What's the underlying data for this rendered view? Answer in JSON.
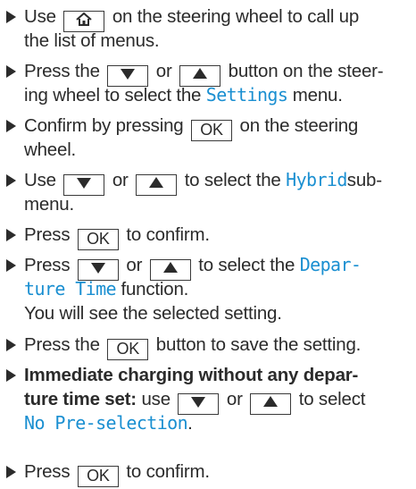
{
  "colors": {
    "text": "#2b2b2b",
    "display_text": "#1a8fd1"
  },
  "icons": {
    "bullet": "arrow-right-icon",
    "home": "home-icon",
    "down": "triangle-down-icon",
    "up": "triangle-up-icon"
  },
  "keys": {
    "ok": "OK"
  },
  "steps": [
    {
      "l1a": "Use",
      "l1b": "on the steering wheel to call up",
      "l2": "the list of menus."
    },
    {
      "l1a": "Press the",
      "l1b": "or",
      "l1c": "button on the steer-",
      "l2a": "ing wheel to select the",
      "l2b": "Settings",
      "l2c": "menu."
    },
    {
      "l1a": "Confirm by pressing",
      "l1b": "on the steering",
      "l2": "wheel."
    },
    {
      "l1a": "Use",
      "l1b": "or",
      "l1c": "to select the",
      "l1d": "Hybrid",
      "l1e": "sub-",
      "l2": "menu."
    },
    {
      "l1a": "Press",
      "l1b": "to confirm."
    },
    {
      "l1a": "Press",
      "l1b": "or",
      "l1c": "to select the",
      "l1d": "Depar-",
      "l2a": "ture Time",
      "l2b": "function.",
      "l3": "You will see the selected setting."
    },
    {
      "l1a": "Press the",
      "l1b": "button to save the setting."
    },
    {
      "l1a": "Immediate charging without any depar-",
      "l2a": "ture time set:",
      "l2b": "use",
      "l2c": "or",
      "l2d": "to select",
      "l3": "No Pre-selection",
      "l3b": "."
    },
    {
      "l1a": "Press",
      "l1b": "to confirm."
    }
  ]
}
